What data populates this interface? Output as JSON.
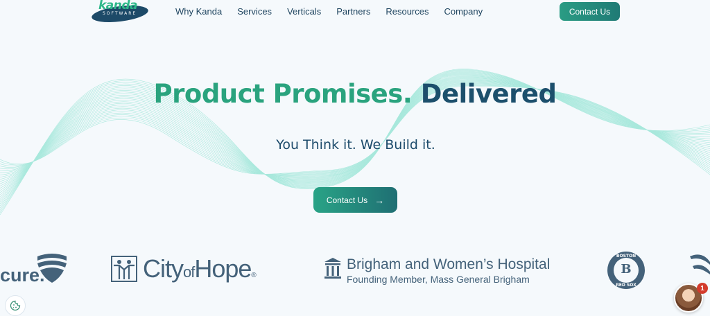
{
  "brand": {
    "name": "kanda",
    "tagline": "SOFTWARE"
  },
  "nav": {
    "items": [
      {
        "label": "Why Kanda"
      },
      {
        "label": "Services"
      },
      {
        "label": "Verticals"
      },
      {
        "label": "Partners"
      },
      {
        "label": "Resources"
      },
      {
        "label": "Company"
      }
    ],
    "cta_label": "Contact Us"
  },
  "hero": {
    "title_green": "Product Promises.",
    "title_dark": "Delivered",
    "subtitle": "You Think it. We Build it.",
    "cta_label": "Contact Us",
    "cta_icon": "arrow-right-icon"
  },
  "clients": {
    "cure_partial": "cure.",
    "city_of_hope": {
      "city": "City",
      "of": "of",
      "hope": "Hope",
      "reg": "®"
    },
    "brigham": {
      "line1": "Brigham and Women’s Hospital",
      "line2": "Founding Member, Mass General Brigham"
    },
    "red_sox": {
      "top": "BOSTON",
      "initial": "B",
      "bottom": "RED SOX"
    }
  },
  "chat": {
    "badge_count": "1"
  },
  "colors": {
    "accent_green": "#2aa37e",
    "dark_blue": "#1c4f6c",
    "logo_gray": "#44627a",
    "badge_red": "#d33b2c"
  }
}
